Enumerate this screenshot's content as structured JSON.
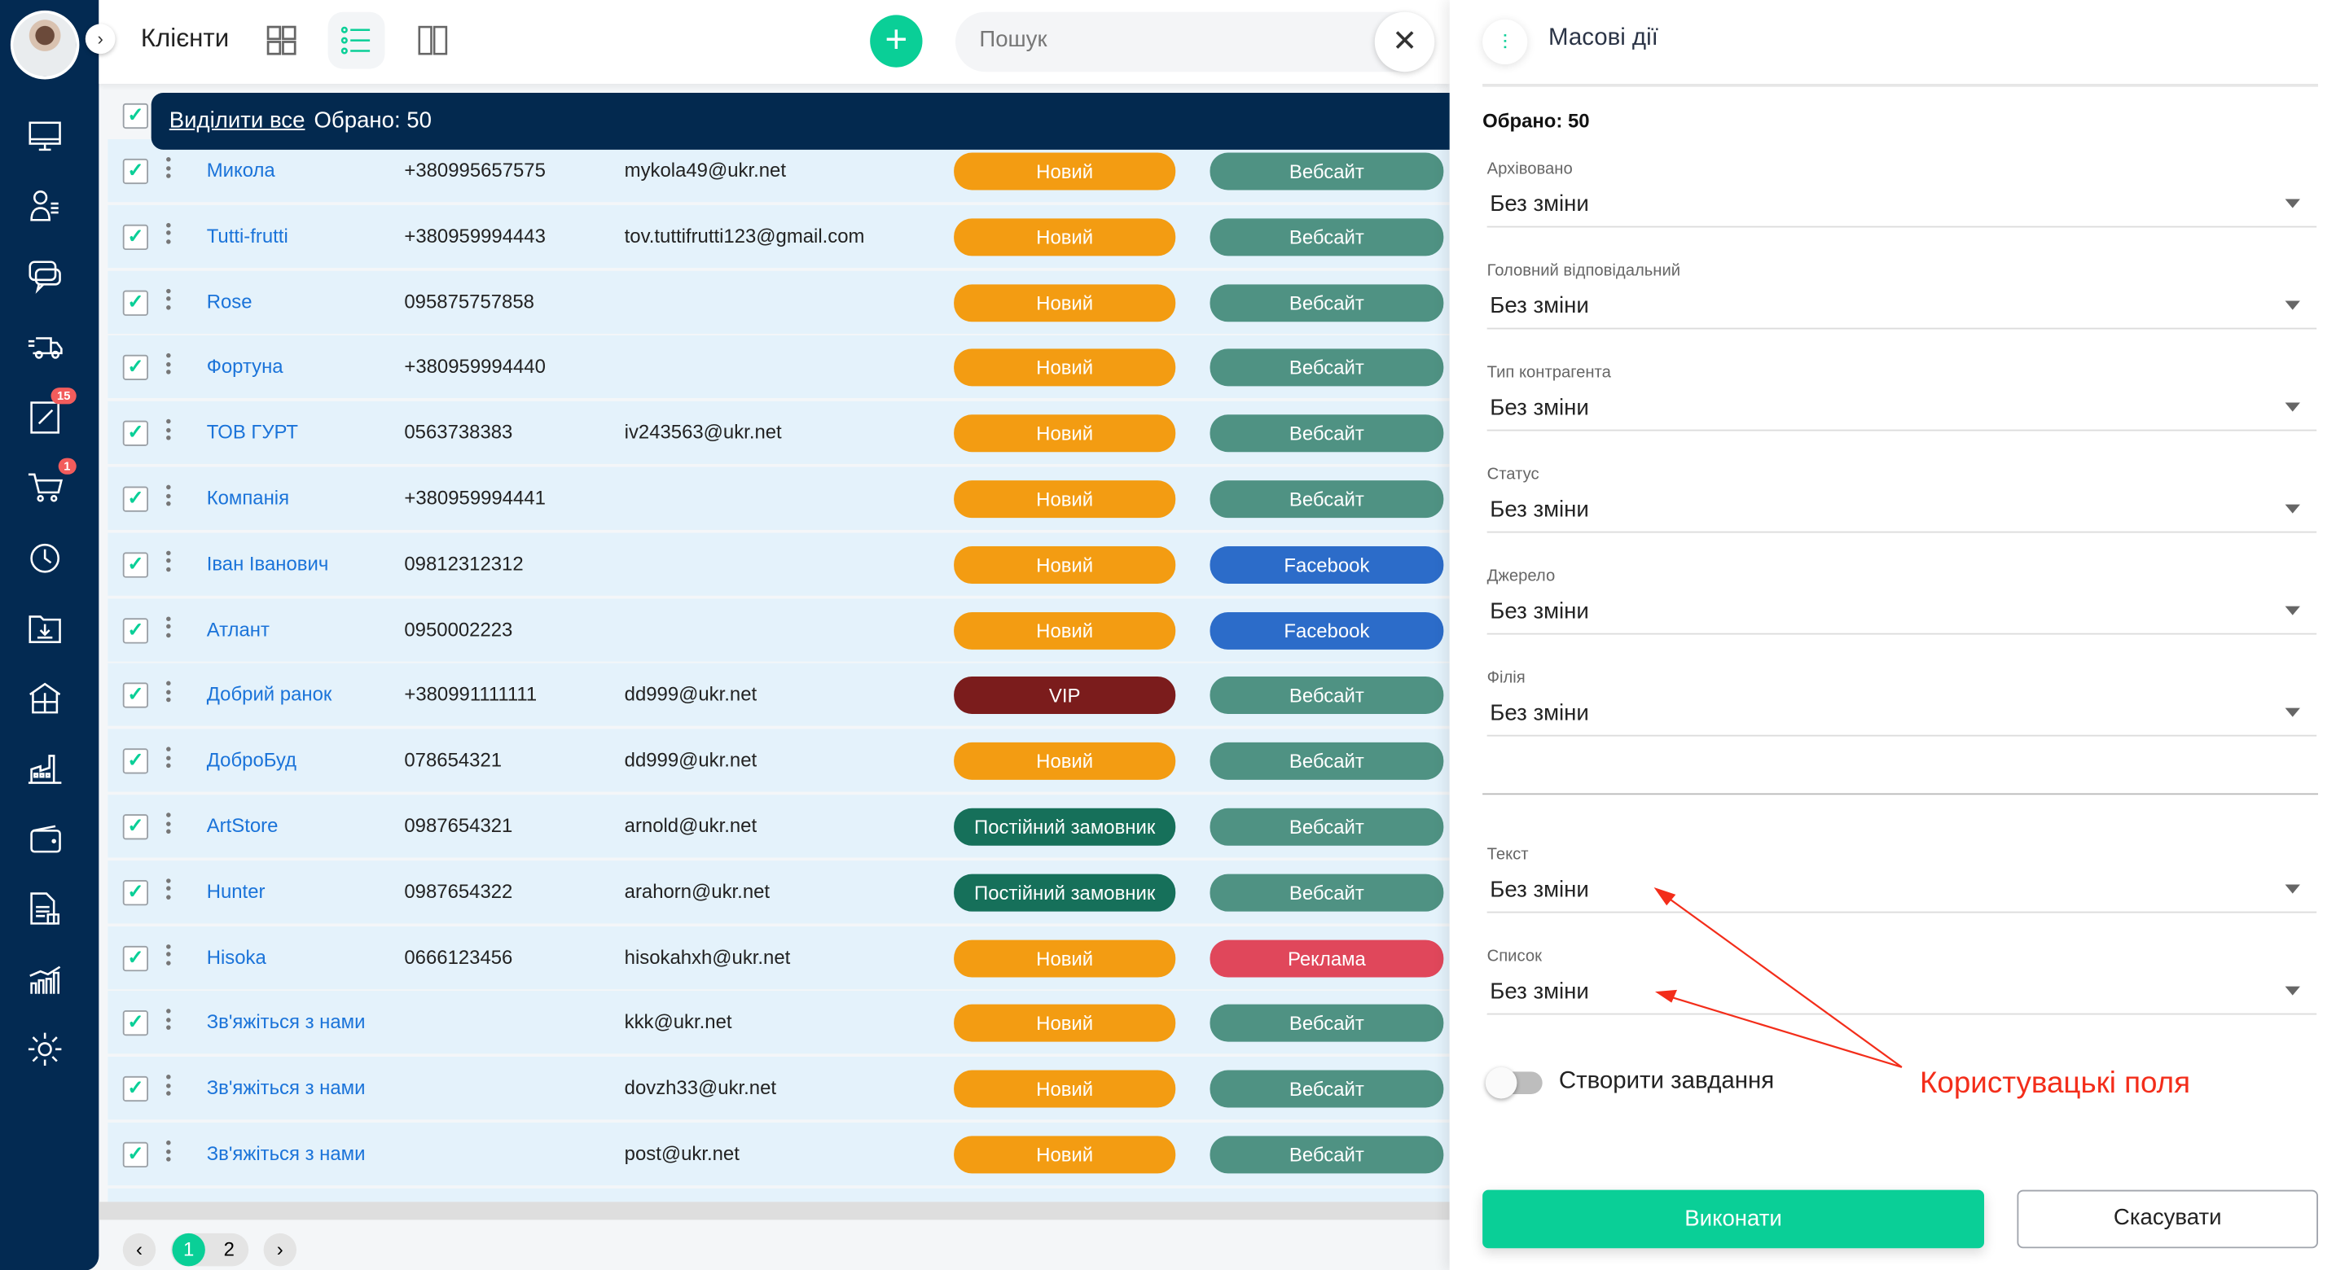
{
  "header": {
    "title": "Клієнти",
    "search_placeholder": "Пошук"
  },
  "sidebar": {
    "badges": {
      "tasks": "15",
      "orders": "1"
    }
  },
  "selection": {
    "select_all": "Виділити все",
    "selected": "Обрано: 50"
  },
  "rows": [
    {
      "name": "Микола",
      "phone": "+380995657575",
      "email": "mykola49@ukr.net",
      "status": "Новий",
      "source": "Вебсайт"
    },
    {
      "name": "Tutti-frutti",
      "phone": "+380959994443",
      "email": "tov.tuttifrutti123@gmail.com",
      "status": "Новий",
      "source": "Вебсайт"
    },
    {
      "name": "Rose",
      "phone": "095875757858",
      "email": "",
      "status": "Новий",
      "source": "Вебсайт"
    },
    {
      "name": "Фортуна",
      "phone": "+380959994440",
      "email": "",
      "status": "Новий",
      "source": "Вебсайт"
    },
    {
      "name": "ТОВ ГУРТ",
      "phone": "0563738383",
      "email": "iv243563@ukr.net",
      "status": "Новий",
      "source": "Вебсайт"
    },
    {
      "name": "Компанія",
      "phone": "+380959994441",
      "email": "",
      "status": "Новий",
      "source": "Вебсайт"
    },
    {
      "name": "Іван Іванович",
      "phone": "09812312312",
      "email": "",
      "status": "Новий",
      "source": "Facebook"
    },
    {
      "name": "Атлант",
      "phone": "0950002223",
      "email": "",
      "status": "Новий",
      "source": "Facebook"
    },
    {
      "name": "Добрий ранок",
      "phone": "+380991111111",
      "email": "dd999@ukr.net",
      "status": "VIP",
      "source": "Вебсайт"
    },
    {
      "name": "ДоброБуд",
      "phone": "078654321",
      "email": "dd999@ukr.net",
      "status": "Новий",
      "source": "Вебсайт"
    },
    {
      "name": "ArtStore",
      "phone": "0987654321",
      "email": "arnold@ukr.net",
      "status": "Постійний замовник",
      "source": "Вебсайт"
    },
    {
      "name": "Hunter",
      "phone": "0987654322",
      "email": "arahorn@ukr.net",
      "status": "Постійний замовник",
      "source": "Вебсайт"
    },
    {
      "name": "Hisoka",
      "phone": "0666123456",
      "email": "hisokahxh@ukr.net",
      "status": "Новий",
      "source": "Реклама"
    },
    {
      "name": "Зв'яжіться з нами",
      "phone": "",
      "email": "kkk@ukr.net",
      "status": "Новий",
      "source": "Вебсайт"
    },
    {
      "name": "Зв'яжіться з нами",
      "phone": "",
      "email": "dovzh33@ukr.net",
      "status": "Новий",
      "source": "Вебсайт"
    },
    {
      "name": "Зв'яжіться з нами",
      "phone": "",
      "email": "post@ukr.net",
      "status": "Новий",
      "source": "Вебсайт"
    }
  ],
  "colors": {
    "accent": "#0acf97",
    "sidebar": "#032a52",
    "Новий": "#f39c12",
    "VIP": "#7b1c1c",
    "Постійний замовник": "#16705a",
    "Вебсайт": "#4f9283",
    "Facebook": "#2c6cc9",
    "Реклама": "#e0475b"
  },
  "pagination": {
    "pages": [
      "1",
      "2"
    ],
    "current": "1"
  },
  "panel": {
    "title": "Масові дії",
    "selected": "Обрано: 50",
    "fields": [
      {
        "label": "Архівовано",
        "value": "Без зміни"
      },
      {
        "label": "Головний відповідальний",
        "value": "Без зміни"
      },
      {
        "label": "Тип контрагента",
        "value": "Без зміни"
      },
      {
        "label": "Статус",
        "value": "Без зміни"
      },
      {
        "label": "Джерело",
        "value": "Без зміни"
      },
      {
        "label": "Філія",
        "value": "Без зміни"
      }
    ],
    "custom_fields": [
      {
        "label": "Текст",
        "value": "Без зміни"
      },
      {
        "label": "Список",
        "value": "Без зміни"
      }
    ],
    "create_task": {
      "label": "Створити завдання",
      "enabled": false
    },
    "run": "Виконати",
    "cancel": "Скасувати",
    "annotation": "Користувацькі поля"
  }
}
